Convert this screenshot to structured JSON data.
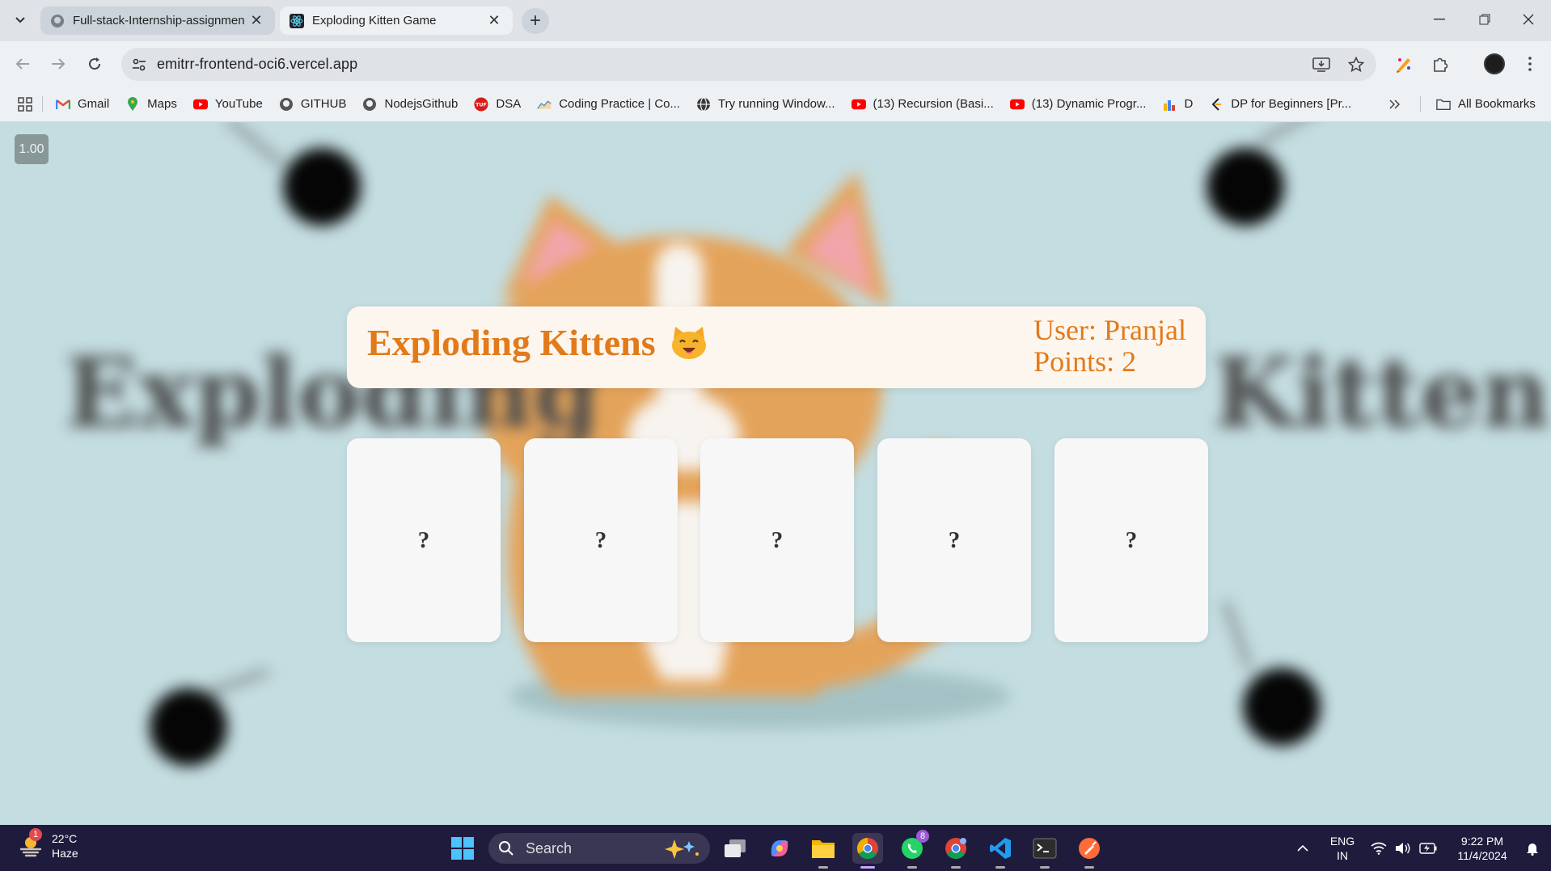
{
  "browser": {
    "tabs": [
      {
        "title": "Full-stack-Internship-assignmen",
        "favicon": "github-icon",
        "active": false
      },
      {
        "title": "Exploding Kitten Game",
        "favicon": "react-icon",
        "active": true
      }
    ],
    "address": "emitrr-frontend-oci6.vercel.app",
    "bookmarks": [
      {
        "label": "Gmail",
        "icon": "gmail-icon"
      },
      {
        "label": "Maps",
        "icon": "maps-icon"
      },
      {
        "label": "YouTube",
        "icon": "youtube-icon"
      },
      {
        "label": "GITHUB",
        "icon": "github-icon"
      },
      {
        "label": "NodejsGithub",
        "icon": "github-icon"
      },
      {
        "label": "DSA",
        "icon": "tuf-icon"
      },
      {
        "label": "Coding Practice | Co...",
        "icon": "chart-icon"
      },
      {
        "label": "Try running Window...",
        "icon": "globe-icon"
      },
      {
        "label": "(13) Recursion (Basi...",
        "icon": "youtube-icon"
      },
      {
        "label": "(13) Dynamic Progr...",
        "icon": "youtube-icon"
      },
      {
        "label": "D",
        "icon": "bar-chart-icon"
      },
      {
        "label": "DP for Beginners [Pr...",
        "icon": "leetcode-icon"
      }
    ],
    "all_bookmarks_label": "All Bookmarks"
  },
  "page": {
    "zoom_badge": "1.00",
    "bg_words": [
      "Exploding",
      "Kitten"
    ],
    "title": "Exploding Kittens",
    "user_line": "User: Pranjal",
    "points_line": "Points: 2",
    "cards": [
      "?",
      "?",
      "?",
      "?",
      "?"
    ]
  },
  "taskbar": {
    "weather_temp": "22°C",
    "weather_desc": "Haze",
    "weather_badge": "1",
    "search_label": "Search",
    "whatsapp_badge": "8",
    "lang_top": "ENG",
    "lang_bottom": "IN",
    "time": "9:22 PM",
    "date": "11/4/2024"
  },
  "colors": {
    "accent_orange": "#e27a1a",
    "page_background": "#c4dde1",
    "taskbar": "#1f1b3d"
  }
}
